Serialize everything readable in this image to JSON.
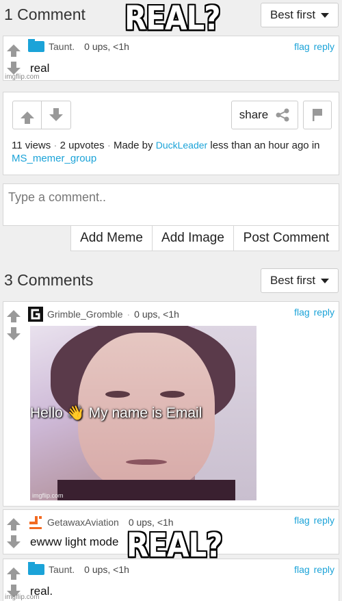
{
  "top_section": {
    "title": "1 Comment",
    "sort_label": "Best first",
    "comment": {
      "username": "Taunt.",
      "meta": "0 ups, <1h",
      "text": "real",
      "flag": "flag",
      "reply": "reply",
      "watermark": "imgflip.com"
    }
  },
  "post_actions": {
    "share_label": "share",
    "views": "11 views",
    "upvotes": "2 upvotes",
    "made_by": "Made by",
    "author": "DuckLeader",
    "time_in": "less than an hour ago in",
    "group": "MS_memer_group"
  },
  "composer": {
    "placeholder": "Type a comment..",
    "add_meme": "Add Meme",
    "add_image": "Add Image",
    "post_comment": "Post Comment"
  },
  "comments_section": {
    "title": "3 Comments",
    "sort_label": "Best first",
    "comments": [
      {
        "username": "Grimble_Gromble",
        "meta": "0 ups, <1h",
        "flag": "flag",
        "reply": "reply",
        "image_caption": "Hello 👋 My name is Email",
        "watermark": "imgflip.com"
      },
      {
        "username": "GetawaxAviation",
        "meta": "0 ups, <1h",
        "text": "ewww light mode",
        "flag": "flag",
        "reply": "reply"
      },
      {
        "username": "Taunt.",
        "meta": "0 ups, <1h",
        "text": "real.",
        "flag": "flag",
        "reply": "reply",
        "watermark": "imgflip.com"
      }
    ]
  },
  "overlay": {
    "caption_top": "REAL?",
    "caption_bottom": "REAL?"
  },
  "colors": {
    "link": "#1ba3d8",
    "background": "#efefef",
    "avatar_blue": "#1ba3d8",
    "avatar_orange": "#f26a21"
  }
}
